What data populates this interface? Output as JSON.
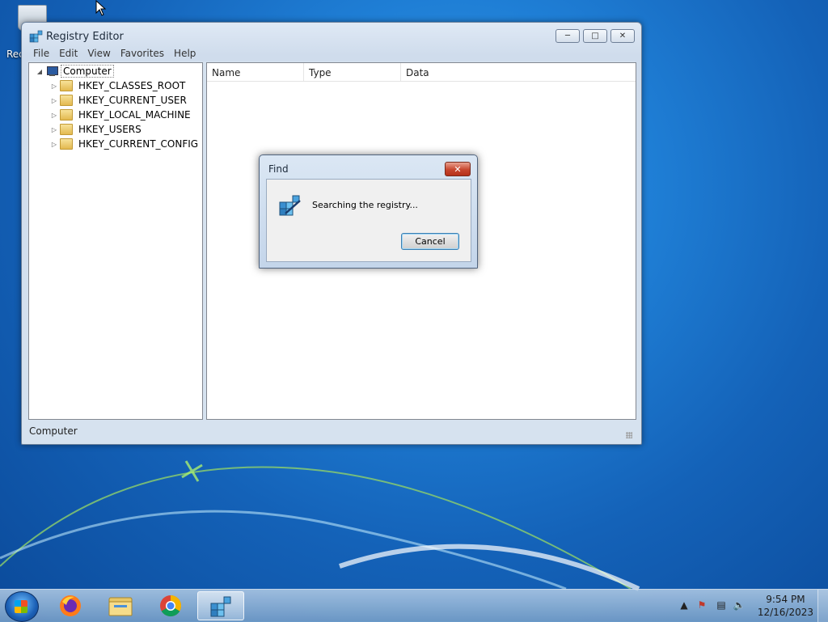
{
  "desktop": {
    "recycle_bin_label": "Rec"
  },
  "window": {
    "title": "Registry Editor",
    "menu": [
      "File",
      "Edit",
      "View",
      "Favorites",
      "Help"
    ],
    "tree": {
      "root": "Computer",
      "children": [
        "HKEY_CLASSES_ROOT",
        "HKEY_CURRENT_USER",
        "HKEY_LOCAL_MACHINE",
        "HKEY_USERS",
        "HKEY_CURRENT_CONFIG"
      ]
    },
    "columns": [
      "Name",
      "Type",
      "Data"
    ],
    "status": "Computer"
  },
  "dialog": {
    "title": "Find",
    "message": "Searching the registry...",
    "cancel_label": "Cancel"
  },
  "taskbar": {
    "apps": [
      "firefox-icon",
      "file-explorer-icon",
      "chrome-icon",
      "registry-editor-icon"
    ],
    "time": "9:54 PM",
    "date": "12/16/2023"
  }
}
